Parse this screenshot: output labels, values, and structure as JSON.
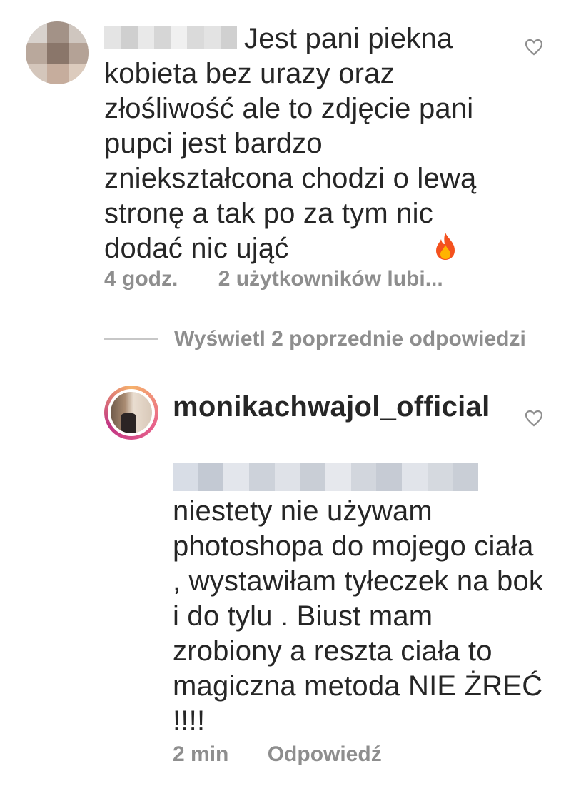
{
  "comment": {
    "text": "Jest pani piekna kobieta bez urazy oraz złośliwość ale to zdjęcie pani pupci jest bardzo zniekształcona chodzi o lewą stronę a tak po za tym nic dodać nic ująć",
    "emoji_icon": "fire-icon",
    "time": "4 godz.",
    "likes": "2 użytkowników lubi..."
  },
  "view_previous_replies": "Wyświetl 2 poprzednie odpowiedzi",
  "reply": {
    "username": "monikachwajol_official",
    "text": "niestety nie używam photoshopa do mojego ciała , wystawiłam tyłeczek na bok i do tylu . Biust mam zrobiony a reszta ciała to magiczna metoda NIE ŻREĆ !!!!",
    "time": "2 min",
    "reply_label": "Odpowiedź"
  },
  "colors": {
    "text": "#262626",
    "secondary": "#8e8e8e",
    "story_ring": "#e8628b"
  }
}
